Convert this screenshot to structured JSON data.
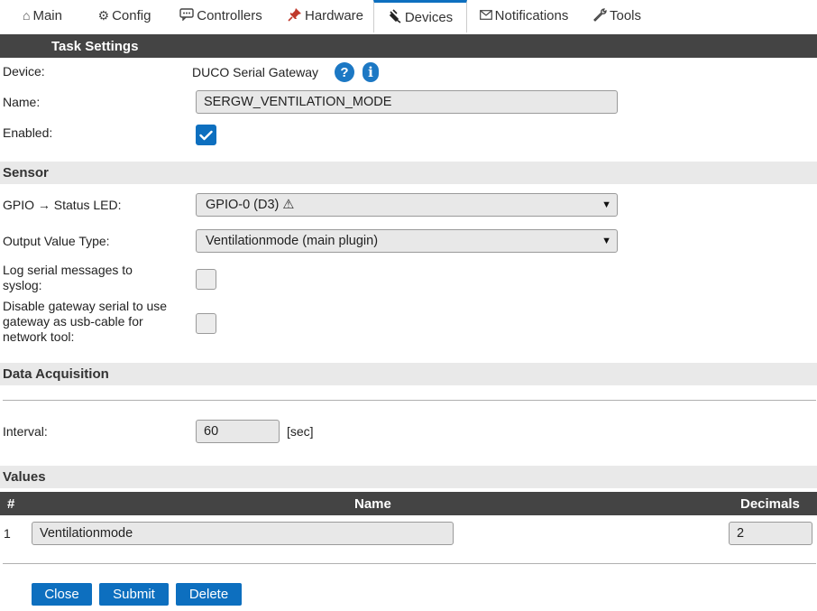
{
  "tabs": [
    {
      "icon": "⌂",
      "icon_name": "home-icon",
      "label": "Main"
    },
    {
      "icon": "⚙",
      "icon_name": "gear-icon",
      "label": "Config"
    },
    {
      "icon": "💬",
      "icon_name": "chat-icon",
      "label": "Controllers"
    },
    {
      "icon": "📌",
      "icon_name": "pin-icon",
      "label": "Hardware"
    },
    {
      "icon": "🔌",
      "icon_name": "plug-icon",
      "label": "Devices"
    },
    {
      "icon": "✉",
      "icon_name": "envelope-icon",
      "label": "Notifications"
    },
    {
      "icon": "🔧",
      "icon_name": "wrench-icon",
      "label": "Tools"
    }
  ],
  "active_tab": "Devices",
  "task_settings": {
    "header": "Task Settings",
    "device_label": "Device:",
    "device_value": "DUCO Serial Gateway",
    "help_icon": "?",
    "info_icon": "i",
    "name_label": "Name:",
    "name_value": "SERGW_VENTILATION_MODE",
    "enabled_label": "Enabled:",
    "enabled": true
  },
  "sensor": {
    "header": "Sensor",
    "gpio_label": "GPIO → Status LED:",
    "gpio_value": "GPIO-0 (D3) ⚠",
    "output_label": "Output Value Type:",
    "output_value": "Ventilationmode (main plugin)",
    "log_label": "Log serial messages to syslog:",
    "log_checked": false,
    "disable_label": "Disable gateway serial to use gateway as usb-cable for network tool:",
    "disable_checked": false
  },
  "data_acquisition": {
    "header": "Data Acquisition",
    "interval_label": "Interval:",
    "interval_value": "60",
    "interval_unit": "[sec]"
  },
  "values": {
    "header": "Values",
    "columns": {
      "num": "#",
      "name": "Name",
      "decimals": "Decimals"
    },
    "rows": [
      {
        "num": "1",
        "name": "Ventilationmode",
        "decimals": "2"
      }
    ]
  },
  "buttons": {
    "close": "Close",
    "submit": "Submit",
    "delete": "Delete"
  },
  "colors": {
    "accent": "#0d6fbf",
    "header_dark": "#444444",
    "header_light": "#e9e9e9"
  }
}
